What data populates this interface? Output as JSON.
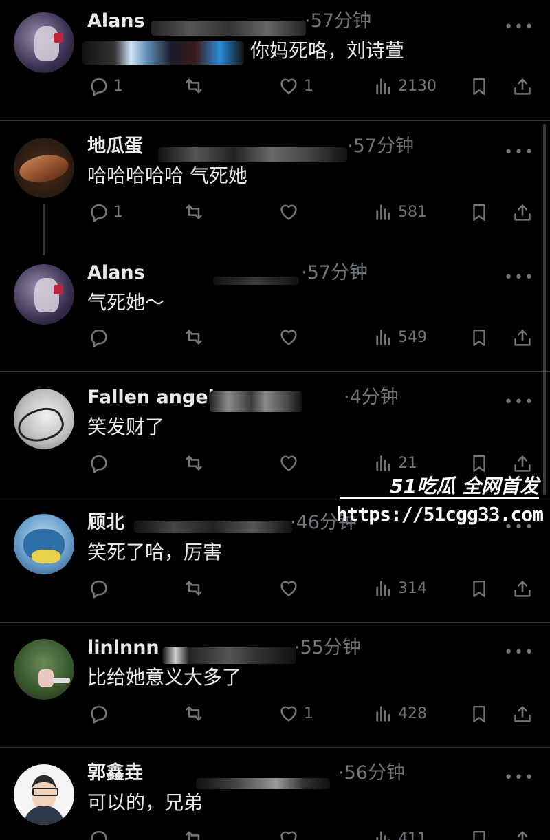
{
  "posts": [
    {
      "name": "Alans",
      "time": "·57分钟",
      "text": "你妈死咯，刘诗萱",
      "replies": "1",
      "likes": "1",
      "views": "2130"
    },
    {
      "name": "地瓜蛋",
      "time": "·57分钟",
      "text": "哈哈哈哈哈 气死她",
      "replies": "1",
      "likes": "",
      "views": "581"
    },
    {
      "name": "Alans",
      "time": "·57分钟",
      "text": "气死她～",
      "replies": "",
      "likes": "",
      "views": "549"
    },
    {
      "name": "Fallen angel",
      "time": "·4分钟",
      "text": "笑发财了",
      "replies": "",
      "likes": "",
      "views": "21"
    },
    {
      "name": "顾北",
      "time": "·46分钟",
      "text": "笑死了哈，厉害",
      "replies": "",
      "likes": "",
      "views": "314"
    },
    {
      "name": "linlnnn",
      "time": "·55分钟",
      "text": "比给她意义大多了",
      "replies": "",
      "likes": "1",
      "views": "428"
    },
    {
      "name": "郭鑫垚",
      "time": "·56分钟",
      "text": "可以的，兄弟",
      "replies": "",
      "likes": "",
      "views": "411"
    }
  ],
  "watermark": {
    "title": "51吃瓜 全网首发",
    "url": "https://51cgg33.com"
  },
  "colors": {
    "background": "#000000",
    "text": "#e7e9ea",
    "muted": "#71767b",
    "divider": "#2f3336"
  }
}
